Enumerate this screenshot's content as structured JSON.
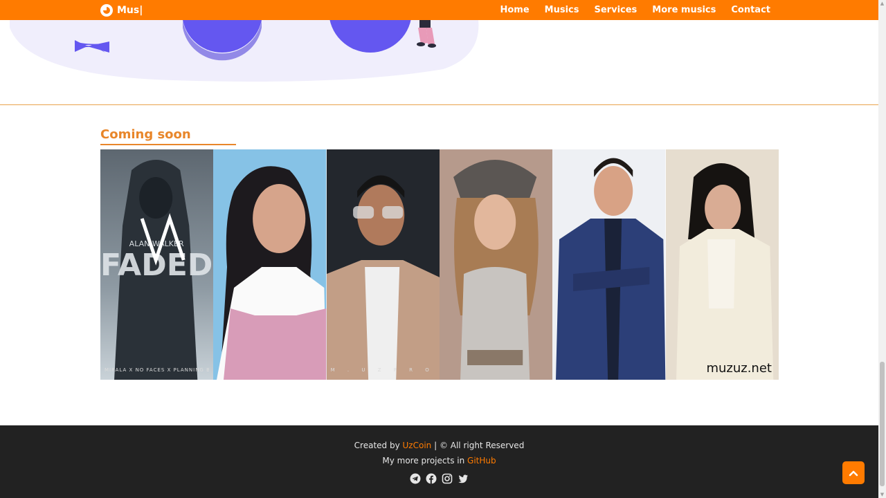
{
  "navbar": {
    "brand": "Mus|",
    "links": [
      "Home",
      "Musics",
      "Services",
      "More musics",
      "Contact"
    ]
  },
  "coming_soon": {
    "title": "Coming soon",
    "cards": [
      {
        "caption": "MIRALA X NO FACES X PLANNING BOOTLA",
        "sign": "ALAN WALKER",
        "sign2": "FADED"
      },
      {
        "caption": ""
      },
      {
        "caption": "M . U Z   P R O D U C T"
      },
      {
        "caption": ""
      },
      {
        "caption": ""
      },
      {
        "caption": "muzuz.net"
      }
    ]
  },
  "footer": {
    "line1_prefix": "Created by ",
    "line1_link": "UzCoin",
    "line1_suffix": " | © All right Reserved",
    "line2_prefix": "My more projects in ",
    "line2_link": "GitHub",
    "socials": [
      "telegram-icon",
      "facebook-icon",
      "instagram-icon",
      "twitter-icon"
    ]
  },
  "colors": {
    "accent": "#ff7b00",
    "footer_bg": "#222222",
    "title": "#e8862a",
    "illustration": "#6457f0"
  }
}
